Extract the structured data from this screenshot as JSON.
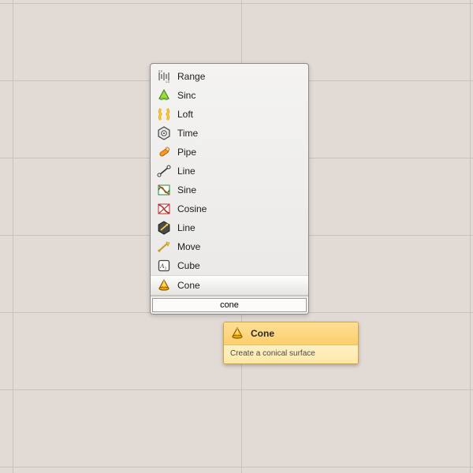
{
  "menu": {
    "items": [
      {
        "label": "Range",
        "icon": "range-icon"
      },
      {
        "label": "Sinc",
        "icon": "sinc-icon"
      },
      {
        "label": "Loft",
        "icon": "loft-icon"
      },
      {
        "label": "Time",
        "icon": "time-icon"
      },
      {
        "label": "Pipe",
        "icon": "pipe-icon"
      },
      {
        "label": "Line",
        "icon": "line-icon"
      },
      {
        "label": "Sine",
        "icon": "sine-icon"
      },
      {
        "label": "Cosine",
        "icon": "cosine-icon"
      },
      {
        "label": "Line",
        "icon": "line-alt-icon"
      },
      {
        "label": "Move",
        "icon": "move-icon"
      },
      {
        "label": "Cube",
        "icon": "cube-text-icon"
      },
      {
        "label": "Cone",
        "icon": "cone-icon",
        "selected": true
      }
    ],
    "search_value": "cone"
  },
  "tooltip": {
    "title": "Cone",
    "description": "Create a conical surface"
  }
}
